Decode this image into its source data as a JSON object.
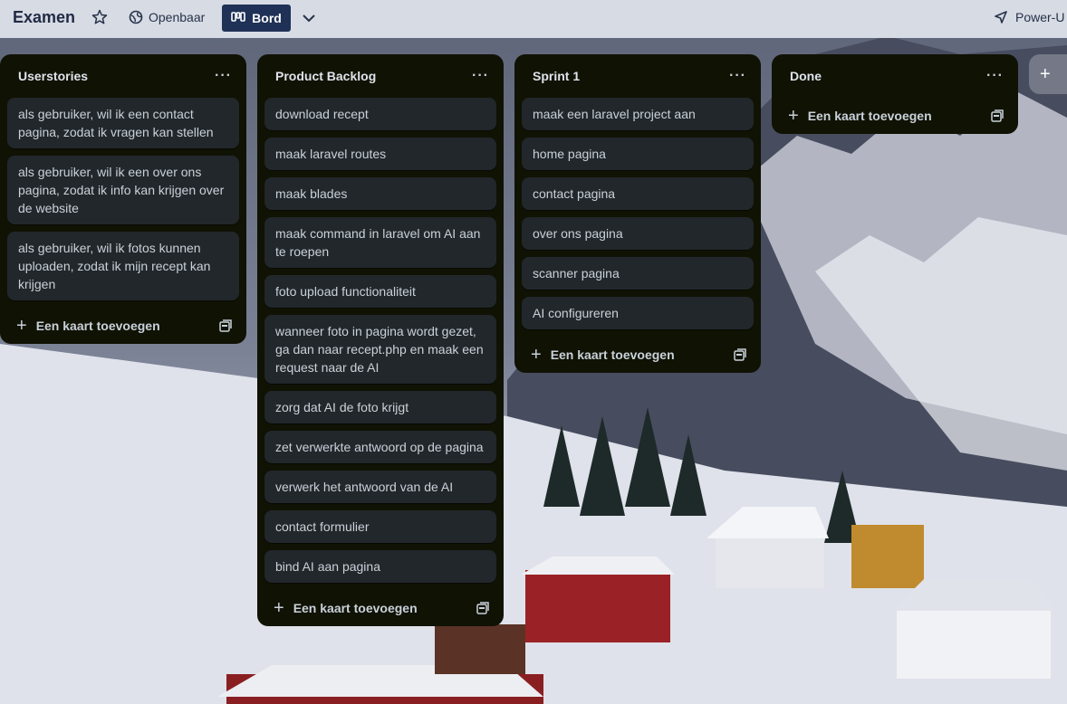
{
  "header": {
    "board_title": "Examen",
    "star_icon": "star-icon",
    "visibility_label": "Openbaar",
    "visibility_icon": "globe-icon",
    "view_label": "Bord",
    "view_icon": "board-icon",
    "power_ups_label": "Power-U",
    "power_ups_icon": "rocket-icon"
  },
  "add_card_label": "Een kaart toevoegen",
  "lists": [
    {
      "title": "Userstories",
      "cards": [
        "als gebruiker, wil ik een contact pagina, zodat ik vragen kan stellen",
        "als gebruiker, wil ik een over ons pagina, zodat ik info kan krijgen over de website",
        "als gebruiker, wil ik fotos kunnen uploaden, zodat ik mijn recept kan krijgen"
      ]
    },
    {
      "title": "Product Backlog",
      "cards": [
        "download recept",
        "maak laravel routes",
        "maak blades",
        "maak command in laravel om AI aan te roepen",
        "foto upload functionaliteit",
        "wanneer foto in pagina wordt gezet, ga dan naar recept.php en maak een request naar de AI",
        "zorg dat AI de foto krijgt",
        "zet verwerkte antwoord op de pagina",
        "verwerk het antwoord van de AI",
        "contact formulier",
        "bind AI aan pagina"
      ]
    },
    {
      "title": "Sprint 1",
      "cards": [
        "maak een laravel project aan",
        "home pagina",
        "contact pagina",
        "over ons pagina",
        "scanner pagina",
        "AI configureren"
      ]
    },
    {
      "title": "Done",
      "cards": []
    }
  ],
  "colors": {
    "list_bg": "#101204",
    "card_bg": "#22272b",
    "card_text": "#c9d1d9",
    "topbar_bg": "#e2e5ed",
    "view_button_bg": "#1f3156"
  }
}
